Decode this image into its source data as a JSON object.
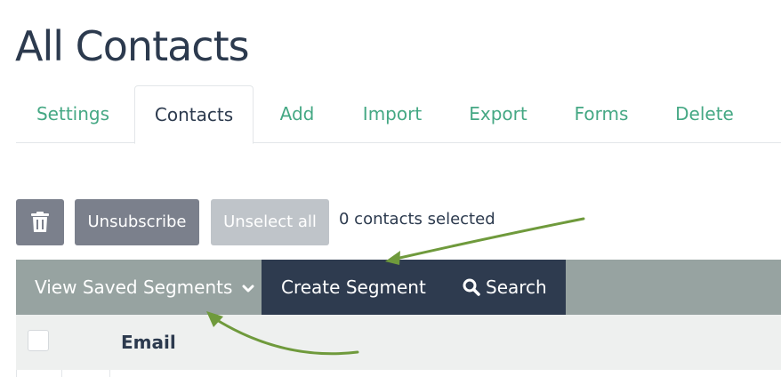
{
  "page": {
    "title": "All Contacts"
  },
  "tabs": [
    {
      "label": "Settings",
      "active": false
    },
    {
      "label": "Contacts",
      "active": true
    },
    {
      "label": "Add",
      "active": false
    },
    {
      "label": "Import",
      "active": false
    },
    {
      "label": "Export",
      "active": false
    },
    {
      "label": "Forms",
      "active": false
    },
    {
      "label": "Delete",
      "active": false
    }
  ],
  "toolbar": {
    "delete_icon": "trash-icon",
    "unsubscribe_label": "Unsubscribe",
    "unselect_all_label": "Unselect all",
    "selected_count_text": "0 contacts selected"
  },
  "segments": {
    "view_saved_label": "View Saved Segments",
    "view_saved_icon": "chevron-down-icon",
    "create_label": "Create Segment",
    "search_label": "Search",
    "search_icon": "search-icon"
  },
  "table": {
    "columns": [
      "Email"
    ]
  },
  "colors": {
    "accent_green": "#45a884",
    "dark_navy": "#2e3b4f",
    "segment_bar": "#97a3a1",
    "button_gray": "#7b808c",
    "button_disabled": "#bfc4c9",
    "annotation_arrow": "#6f9a3c"
  }
}
